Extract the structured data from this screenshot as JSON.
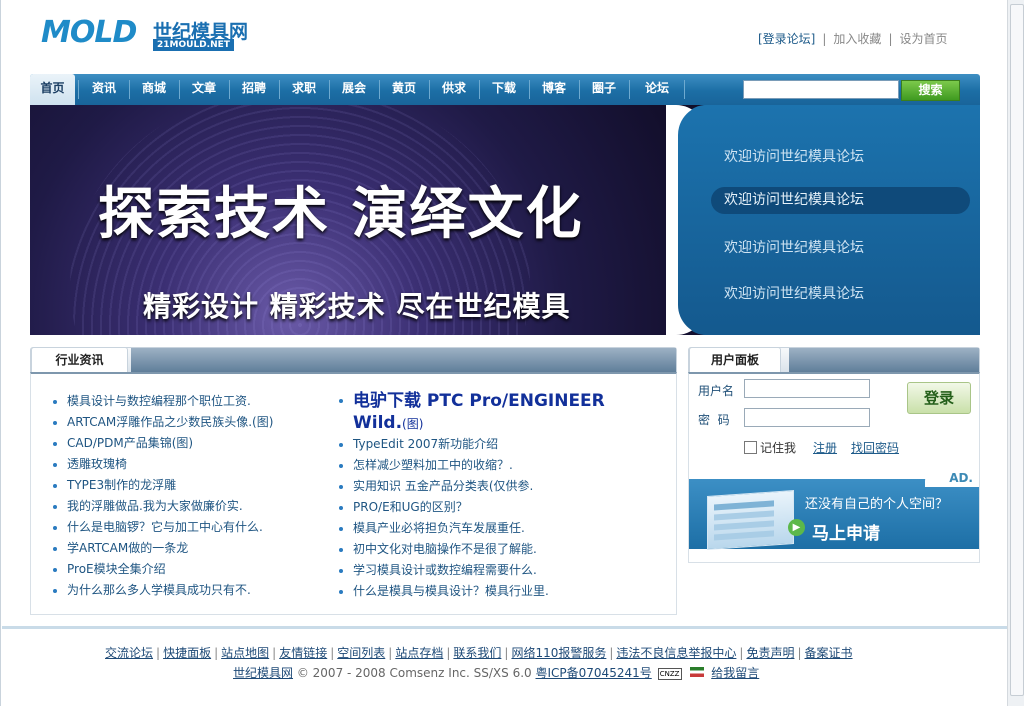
{
  "site": {
    "logo_en": "MOLD",
    "logo_cn": "世纪模具网",
    "logo_domain": "21MOULD.NET"
  },
  "toplinks": [
    "[登录论坛]",
    "加入收藏",
    "设为首页"
  ],
  "nav": {
    "items": [
      "首页",
      "资讯",
      "商城",
      "文章",
      "招聘",
      "求职",
      "展会",
      "黄页",
      "供求",
      "下载",
      "博客",
      "圈子",
      "论坛"
    ],
    "active": "首页",
    "search_value": "",
    "search_button": "搜索"
  },
  "banner": {
    "headline": "探索技术 演绎文化",
    "subline": "精彩设计 精彩技术 尽在世纪模具",
    "messages": [
      "欢迎访问世纪模具论坛",
      "欢迎访问世纪模具论坛",
      "欢迎访问世纪模具论坛",
      "欢迎访问世纪模具论坛"
    ],
    "selected_index": 1
  },
  "news": {
    "title": "行业资讯",
    "left": [
      "模具设计与数控编程那个职位工资.",
      "ARTCAM浮雕作品之少数民族头像.(图)",
      "CAD/PDM产品集锦(图)",
      "透雕玫瑰椅",
      "TYPE3制作的龙浮雕",
      "我的浮雕做品.我为大家做廉价实.",
      "什么是电脑锣？它与加工中心有什么.",
      "学ARTCAM做的一条龙",
      "ProE模块全集介绍",
      "为什么那么多人学模具成功只有不."
    ],
    "right_headline": "电驴下载 PTC Pro/ENGINEER Wild.",
    "right_headline_suffix": "(图)",
    "right": [
      "TypeEdit 2007新功能介绍",
      "怎样减少塑料加工中的收缩？.",
      "实用知识 五金产品分类表(仅供参.",
      "PRO/E和UG的区别？",
      "模具产业必将担负汽车发展重任.",
      "初中文化对电脑操作不是很了解能.",
      "学习模具设计或数控编程需要什么.",
      "什么是模具与模具设计？模具行业里."
    ]
  },
  "user_panel": {
    "title": "用户面板",
    "username_label": "用户名",
    "password_label": "密  码",
    "username_value": "",
    "password_value": "",
    "login_button": "登录",
    "remember_label": "记住我",
    "register_link": "注册",
    "recover_link": "找回密码",
    "ad_tag": "AD.",
    "ad_question": "还没有自己的个人空间？",
    "ad_apply": "马上申请"
  },
  "footer": {
    "links": [
      "交流论坛",
      "快捷面板",
      "站点地图",
      "友情链接",
      "空间列表",
      "站点存档",
      "联系我们",
      "网络110报警服务",
      "违法不良信息举报中心",
      "免责声明",
      "备案证书"
    ],
    "site_name": "世纪模具网",
    "copyright": "© 2007 - 2008 Comsenz Inc. SS/XS 6.0",
    "icp": "粤ICP备07045241号",
    "cnzz": "CNZZ",
    "message_link": "给我留言"
  }
}
